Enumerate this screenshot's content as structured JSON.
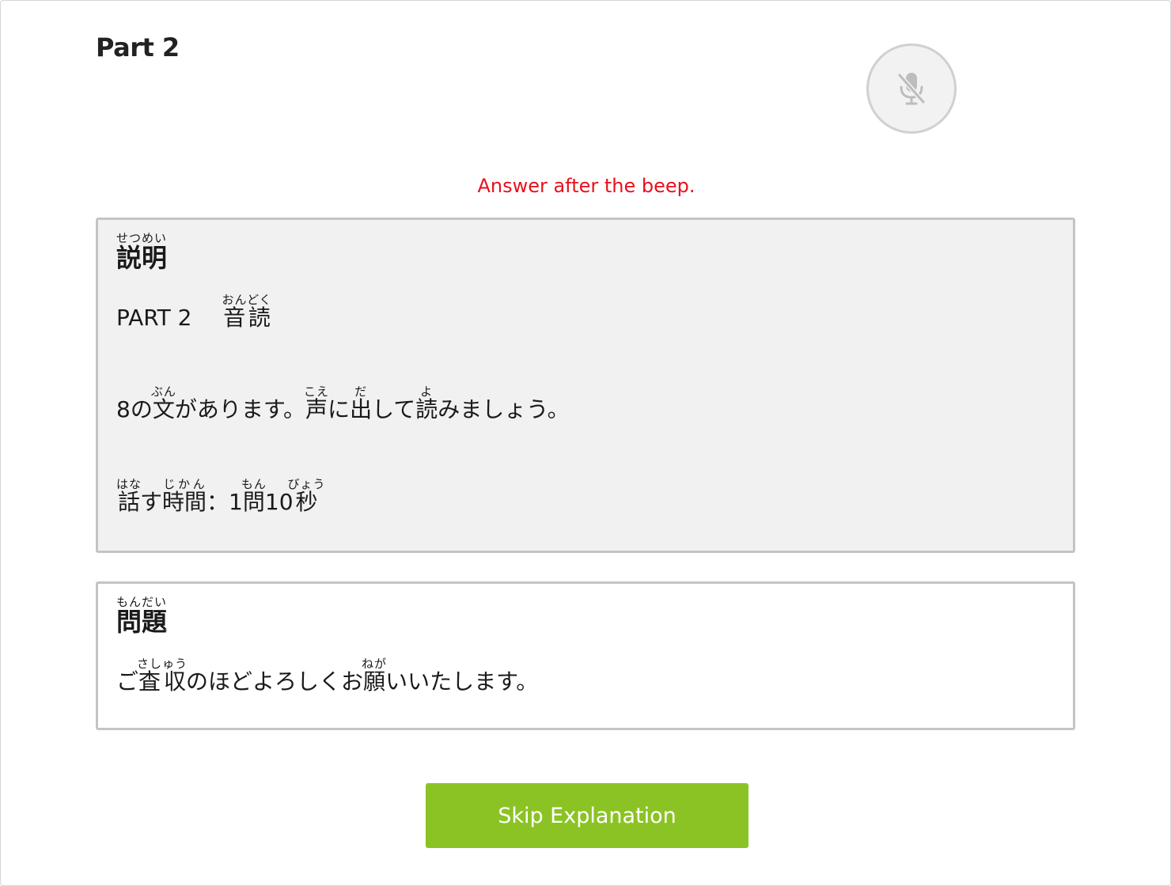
{
  "header": {
    "part_title": "Part 2",
    "mic_icon": "mic-off-icon",
    "mic_state": "muted"
  },
  "instruction": {
    "text": "Answer after the beep.",
    "color": "#e8101c"
  },
  "explanation": {
    "heading": {
      "base": "説明",
      "ruby": "せつめい"
    },
    "part_line": {
      "prefix": "PART 2",
      "word": {
        "base": "音読",
        "ruby": "おんどく"
      }
    },
    "sentence_line": {
      "t1": "8の",
      "r1": {
        "base": "文",
        "ruby": "ぶん"
      },
      "t2": "があります。",
      "r2": {
        "base": "声",
        "ruby": "こえ"
      },
      "t3": "に",
      "r3": {
        "base": "出",
        "ruby": "だ"
      },
      "t4": "して",
      "r4": {
        "base": "読",
        "ruby": "よ"
      },
      "t5": "みましょう。"
    },
    "time_line": {
      "r1": {
        "base": "話",
        "ruby": "はな"
      },
      "t1": "す",
      "r2": {
        "base": "時間",
        "ruby": "じかん"
      },
      "t2": "：1",
      "r3": {
        "base": "問",
        "ruby": "もん"
      },
      "t3": "10",
      "r4": {
        "base": "秒",
        "ruby": "びょう"
      }
    }
  },
  "question": {
    "heading": {
      "base": "問題",
      "ruby": "もんだい"
    },
    "sentence": {
      "t1": "ご",
      "r1": {
        "base": "査収",
        "ruby": "さしゅう"
      },
      "t2": "のほどよろしくお",
      "r2": {
        "base": "願",
        "ruby": "ねが"
      },
      "t3": "いいたします。"
    }
  },
  "actions": {
    "skip_label": "Skip Explanation",
    "skip_color": "#8bc325"
  }
}
